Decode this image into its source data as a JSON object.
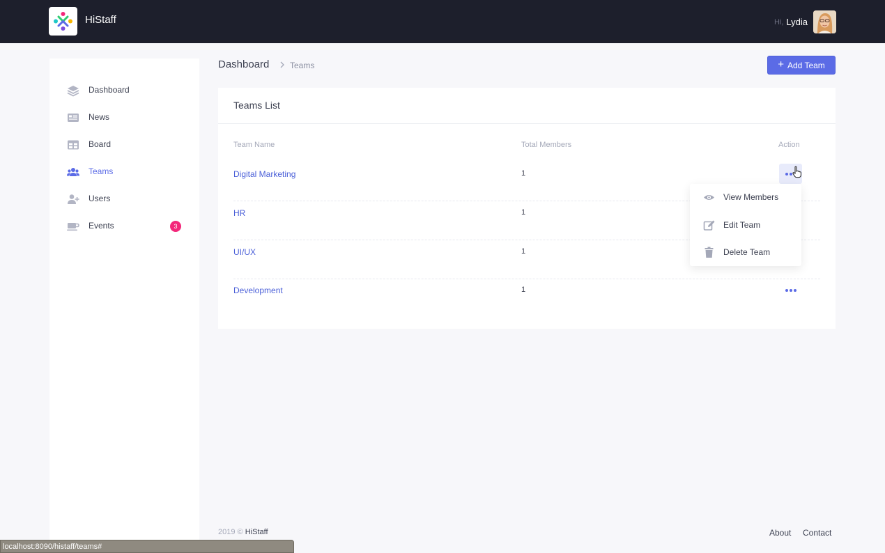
{
  "header": {
    "app_title": "HiStaff",
    "greeting": "Hi,",
    "user_name": "Lydia"
  },
  "sidebar": {
    "items": [
      {
        "label": "Dashboard",
        "icon": "layers-icon"
      },
      {
        "label": "News",
        "icon": "newspaper-icon"
      },
      {
        "label": "Board",
        "icon": "table-icon"
      },
      {
        "label": "Teams",
        "icon": "users-icon",
        "active": true
      },
      {
        "label": "Users",
        "icon": "user-plus-icon"
      },
      {
        "label": "Events",
        "icon": "coffee-icon",
        "badge": "3"
      }
    ]
  },
  "breadcrumb": {
    "root": "Dashboard",
    "current": "Teams"
  },
  "toolbar": {
    "add_label": "Add Team"
  },
  "card": {
    "title": "Teams List",
    "columns": [
      "Team Name",
      "Total Members",
      "Action"
    ],
    "rows": [
      {
        "name": "Digital Marketing",
        "members": "1"
      },
      {
        "name": "HR",
        "members": "1"
      },
      {
        "name": "UI/UX",
        "members": "1"
      },
      {
        "name": "Development",
        "members": "1"
      }
    ]
  },
  "menu": {
    "items": [
      {
        "label": "View Members",
        "icon": "eye-icon"
      },
      {
        "label": "Edit Team",
        "icon": "edit-icon"
      },
      {
        "label": "Delete Team",
        "icon": "trash-icon"
      }
    ]
  },
  "footer": {
    "year": "2019",
    "copyright": "©",
    "brand": "HiStaff",
    "about": "About",
    "contact": "Contact"
  },
  "status": {
    "url": "localhost:8090/histaff/teams#"
  },
  "colors": {
    "accent": "#5b6be6",
    "topbar": "#1d1f2c",
    "badge": "#f3277a"
  }
}
